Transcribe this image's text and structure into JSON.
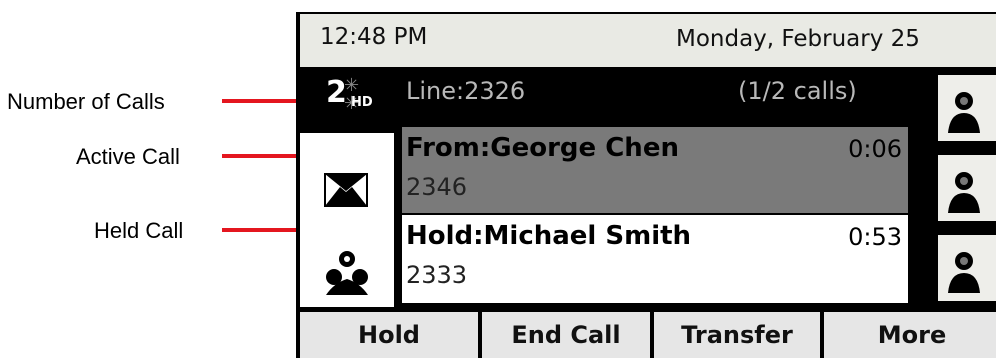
{
  "annotations": [
    {
      "label": "Number of Calls"
    },
    {
      "label": "Active Call"
    },
    {
      "label": "Held Call"
    }
  ],
  "status_bar": {
    "time": "12:48 PM",
    "date": "Monday, February 25"
  },
  "line_indicator": {
    "count": "2",
    "badge": "HD",
    "icon": "line-status-icon"
  },
  "left_icons": [
    {
      "icon": "envelope-icon"
    },
    {
      "icon": "contacts-icon"
    }
  ],
  "call_panel": {
    "line_label": "Line:2326",
    "calls_count": "(1/2 calls)",
    "calls": [
      {
        "state": "active",
        "name": "From:George Chen",
        "timer": "0:06",
        "number": "2346"
      },
      {
        "state": "held",
        "name": "Hold:Michael Smith",
        "timer": "0:53",
        "number": "2333"
      }
    ]
  },
  "speed_dial": [
    {
      "icon": "person-icon"
    },
    {
      "icon": "person-icon"
    },
    {
      "icon": "person-icon"
    }
  ],
  "softkeys": [
    {
      "label": "Hold"
    },
    {
      "label": "End Call"
    },
    {
      "label": "Transfer"
    },
    {
      "label": "More"
    }
  ],
  "colors": {
    "callout": "#e4161f",
    "active_row": "#7a7a7a",
    "held_row": "#ffffff",
    "status_bar": "#e9eae4"
  }
}
